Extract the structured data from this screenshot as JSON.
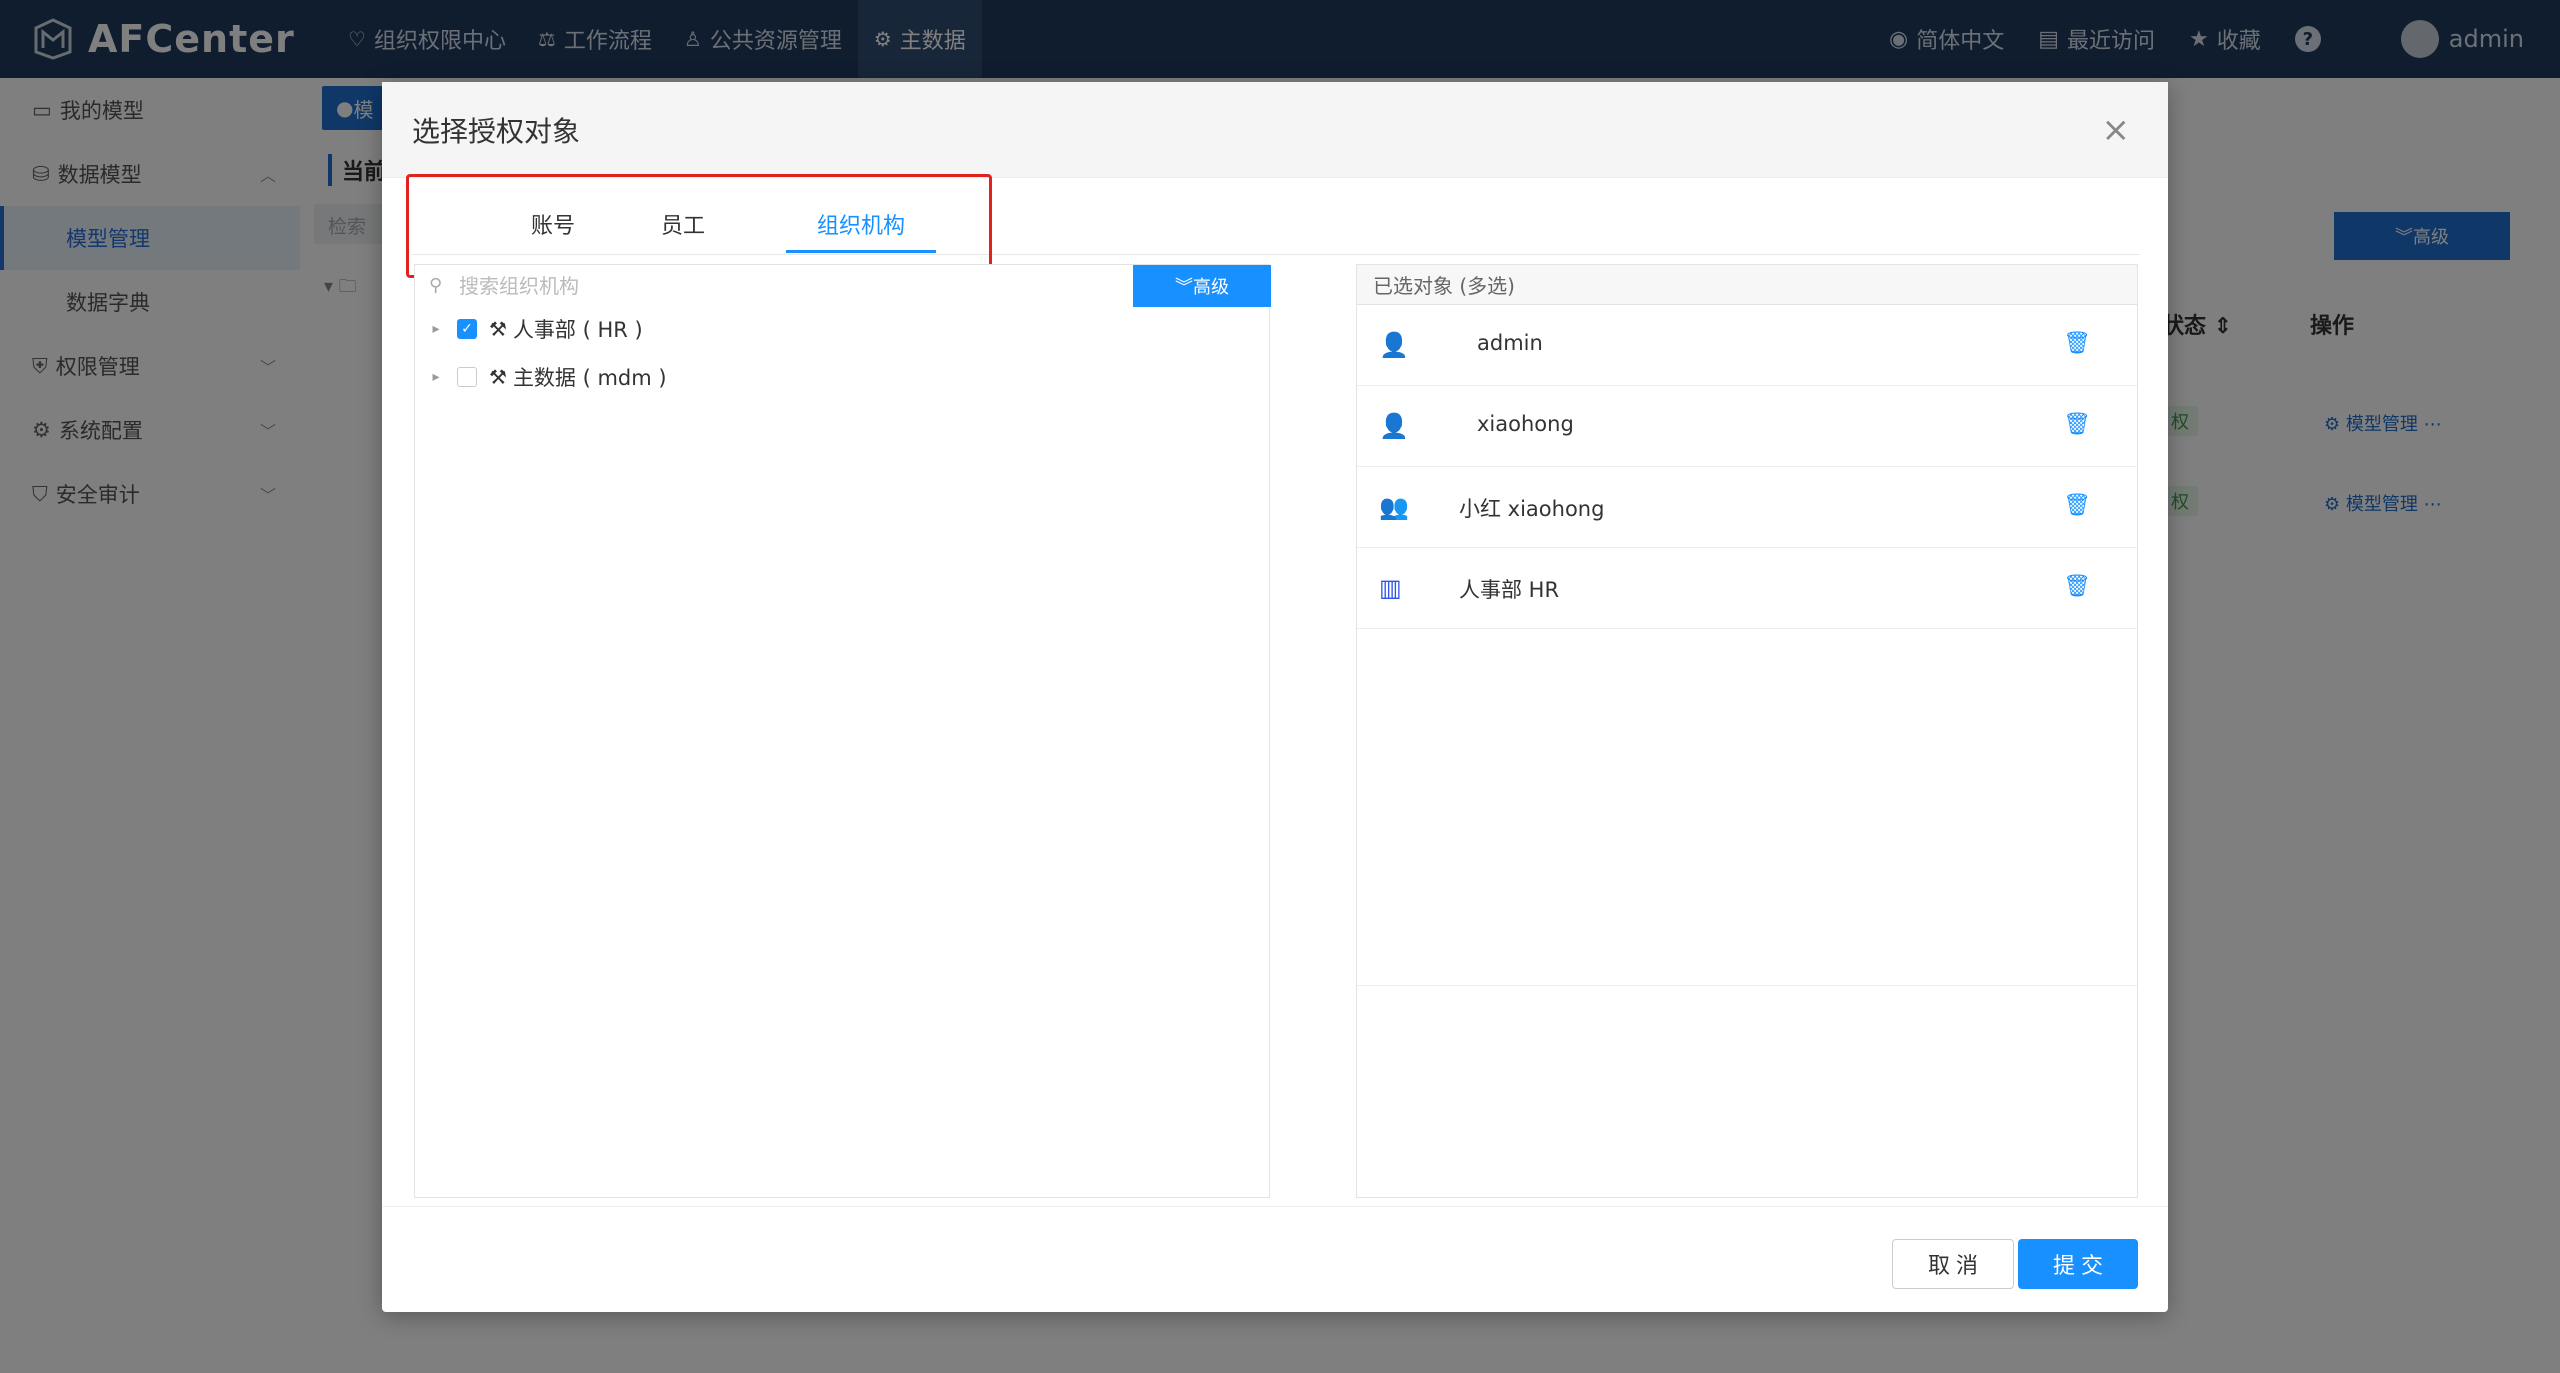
{
  "app": {
    "name": "AFCenter",
    "nav": [
      "组织权限中心",
      "工作流程",
      "公共资源管理",
      "主数据"
    ],
    "lang": "简体中文",
    "recent": "最近访问",
    "favorites": "收藏",
    "help": "?",
    "user": "admin"
  },
  "sidebar": {
    "items": [
      {
        "label": "我的模型"
      },
      {
        "label": "数据模型"
      },
      {
        "label": "模型管理"
      },
      {
        "label": "数据字典"
      },
      {
        "label": "权限管理"
      },
      {
        "label": "系统配置"
      },
      {
        "label": "安全审计"
      }
    ]
  },
  "background": {
    "tab_label": "模",
    "current_label": "当前",
    "search_placeholder": "检索",
    "adv_label": "高级",
    "col_status": "状态",
    "col_op": "操作",
    "row_badge": "权",
    "row_op": "模型管理"
  },
  "modal": {
    "title": "选择授权对象",
    "close": "×",
    "tabs": [
      "账号",
      "员工",
      "组织机构"
    ],
    "search_placeholder": "搜索组织机构",
    "adv_button": "高级",
    "tree": [
      {
        "label": "人事部 ( HR )",
        "checked": true
      },
      {
        "label": "主数据 ( mdm )",
        "checked": false
      }
    ],
    "selected_header": "已选对象 (多选)",
    "selected": [
      {
        "name": "admin",
        "type": "account",
        "icon": "user-icon"
      },
      {
        "name": "xiaohong",
        "type": "account",
        "icon": "user-icon"
      },
      {
        "name": "小红   xiaohong",
        "type": "employee",
        "icon": "employee-icon"
      },
      {
        "name": "人事部   HR",
        "type": "org",
        "icon": "building-icon"
      }
    ],
    "cancel": "取 消",
    "submit": "提 交"
  },
  "colors": {
    "topbar": "#1f3a5f",
    "primary": "#1890ff",
    "highlight": "#e0231f",
    "account_icon": "#f08a24",
    "employee_icon": "#1890ff",
    "org_icon": "#2f54eb"
  }
}
